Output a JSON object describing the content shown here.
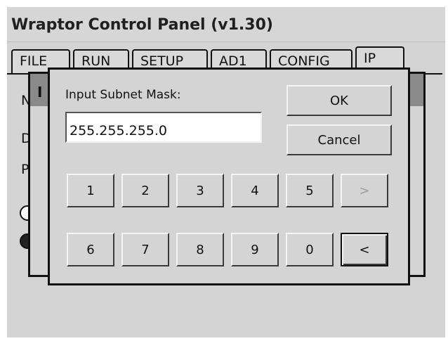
{
  "window": {
    "title": "Wraptor Control Panel (v1.30)"
  },
  "tabs": [
    {
      "label": "FILE",
      "active": false
    },
    {
      "label": "RUN",
      "active": false
    },
    {
      "label": "SETUP",
      "active": false
    },
    {
      "label": "AD1",
      "active": false
    },
    {
      "label": "CONFIG",
      "active": false
    },
    {
      "label": "IP",
      "active": true
    }
  ],
  "background_panel": {
    "row_letters": [
      "N",
      "D",
      "P"
    ],
    "radio_options": [
      {
        "selected": false
      },
      {
        "selected": true
      }
    ]
  },
  "background_dialog": {
    "title_fragment": "I"
  },
  "dialog": {
    "prompt": "Input Subnet Mask:",
    "value": "255.255.255.0",
    "ok_label": "OK",
    "cancel_label": "Cancel",
    "keypad": {
      "row1": [
        "1",
        "2",
        "3",
        "4",
        "5"
      ],
      "forward_label": ">",
      "forward_enabled": false,
      "row2": [
        "6",
        "7",
        "8",
        "9",
        "0"
      ],
      "back_label": "<"
    }
  }
}
